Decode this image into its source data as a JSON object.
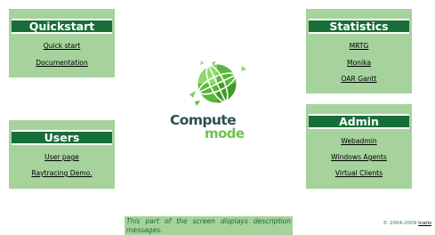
{
  "quickstart": {
    "title": "Quickstart",
    "links": [
      "Quick start",
      "Documentation"
    ]
  },
  "users": {
    "title": "Users",
    "links": [
      "User page",
      "Raytracing Demo."
    ]
  },
  "statistics": {
    "title": "Statistics",
    "links": [
      "MRTG",
      "Monika",
      "OAR Gantt"
    ]
  },
  "admin": {
    "title": "Admin",
    "links": [
      "Webadmin",
      "Windows Agents",
      "Virtual Clients"
    ]
  },
  "logo": {
    "line1": "Compute",
    "line2": "mode",
    "icon": "globe-logo-icon"
  },
  "description": {
    "text": "This part of the screen displays description messages."
  },
  "footer": {
    "copyright": "© 2004-2009",
    "link": "Icatis"
  },
  "colors": {
    "panel_bg": "#a6d29c",
    "title_bar": "#196d39",
    "logo_dark": "#2f4f4f",
    "logo_green": "#6fc24f"
  }
}
